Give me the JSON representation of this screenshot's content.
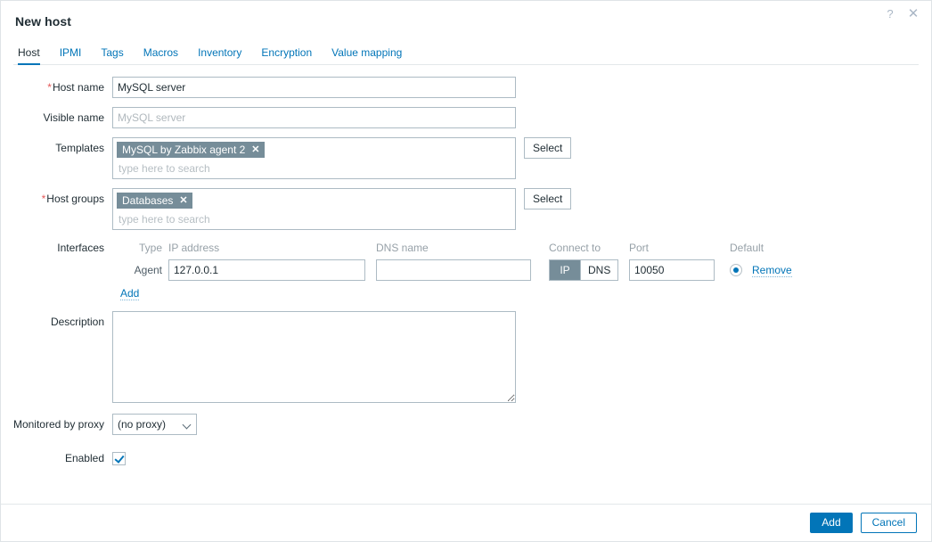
{
  "dialog": {
    "title": "New host",
    "help_icon": "?",
    "close_icon": "✕"
  },
  "tabs": [
    {
      "label": "Host",
      "active": true
    },
    {
      "label": "IPMI",
      "active": false
    },
    {
      "label": "Tags",
      "active": false
    },
    {
      "label": "Macros",
      "active": false
    },
    {
      "label": "Inventory",
      "active": false
    },
    {
      "label": "Encryption",
      "active": false
    },
    {
      "label": "Value mapping",
      "active": false
    }
  ],
  "form": {
    "host_name": {
      "label": "Host name",
      "required": "*",
      "value": "MySQL server",
      "placeholder": ""
    },
    "visible_name": {
      "label": "Visible name",
      "value": "",
      "placeholder": "MySQL server"
    },
    "templates": {
      "label": "Templates",
      "chips": [
        "MySQL by Zabbix agent 2"
      ],
      "chip_remove_icon": "✕",
      "search_placeholder": "type here to search",
      "select_label": "Select"
    },
    "host_groups": {
      "label": "Host groups",
      "required": "*",
      "chips": [
        "Databases"
      ],
      "chip_remove_icon": "✕",
      "search_placeholder": "type here to search",
      "select_label": "Select"
    },
    "interfaces": {
      "label": "Interfaces",
      "columns": {
        "type": "Type",
        "ip": "IP address",
        "dns": "DNS name",
        "connect_to": "Connect to",
        "port": "Port",
        "default": "Default"
      },
      "rows": [
        {
          "type": "Agent",
          "ip": "127.0.0.1",
          "dns": "",
          "dns_placeholder": "",
          "connect_to": {
            "ip_label": "IP",
            "dns_label": "DNS",
            "selected": "IP"
          },
          "port": "10050",
          "default_selected": true,
          "remove_label": "Remove"
        }
      ],
      "add_label": "Add"
    },
    "description": {
      "label": "Description",
      "value": "",
      "placeholder": ""
    },
    "monitored_by_proxy": {
      "label": "Monitored by proxy",
      "value": "(no proxy)",
      "options": [
        "(no proxy)"
      ]
    },
    "enabled": {
      "label": "Enabled",
      "checked": true
    }
  },
  "footer": {
    "submit_label": "Add",
    "cancel_label": "Cancel"
  },
  "colors": {
    "accent": "#0275b8",
    "chip_bg": "#768d99",
    "required": "#e45959",
    "border": "#adbbc4",
    "muted_text": "#97a1a8"
  }
}
